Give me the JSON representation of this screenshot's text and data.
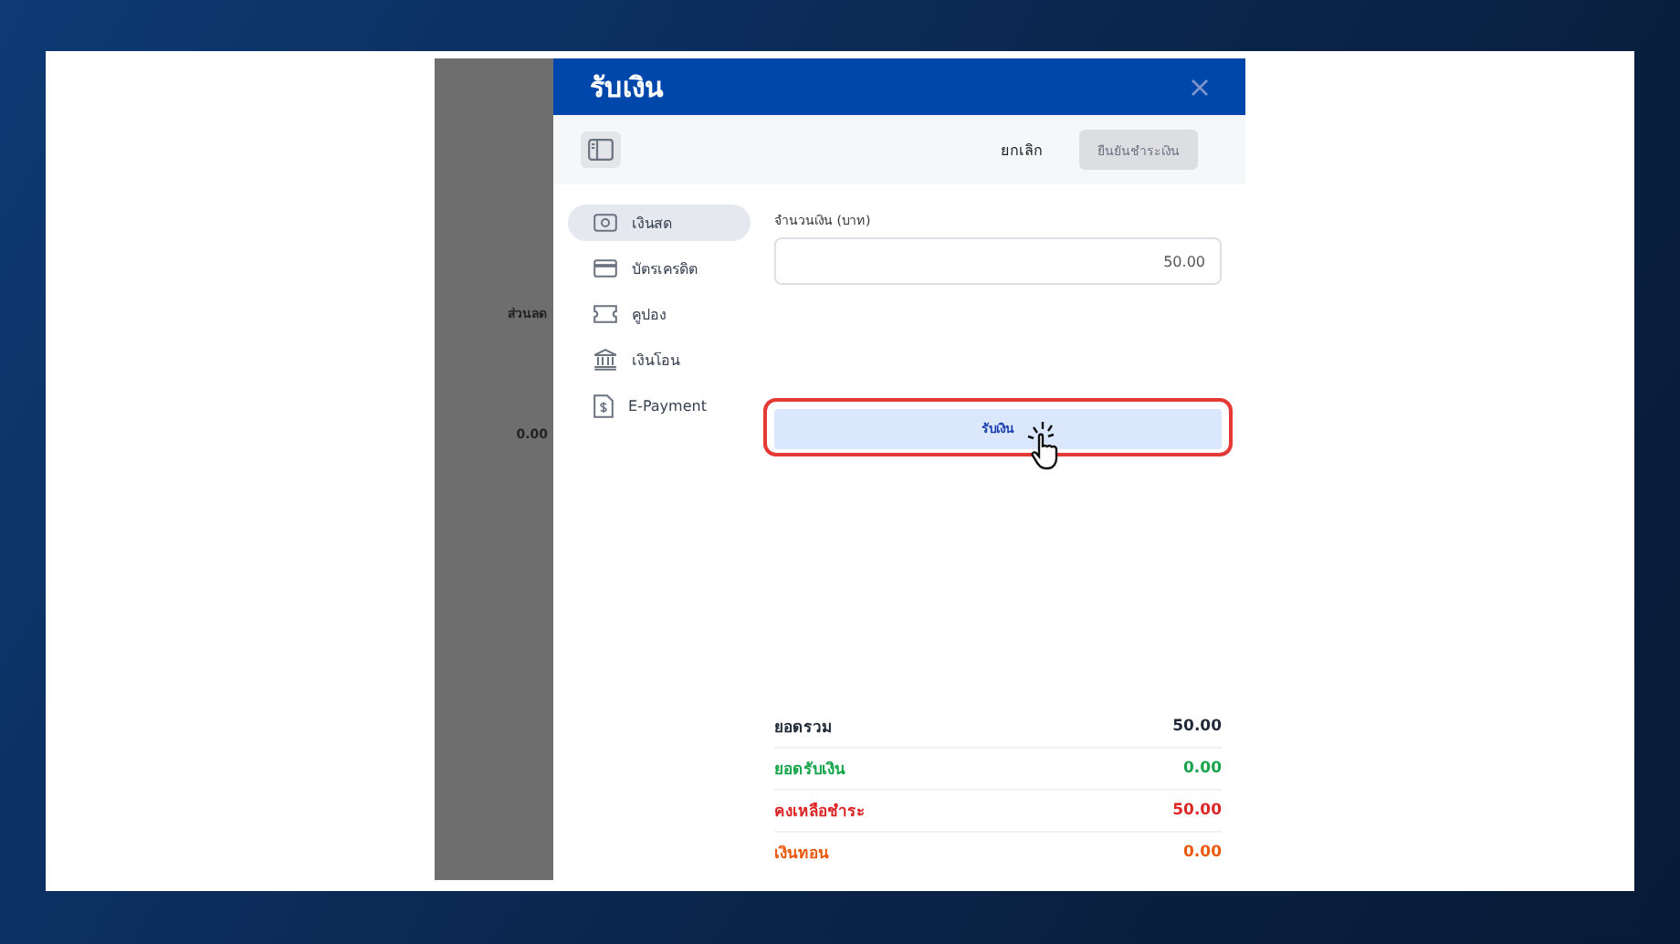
{
  "background_page": {
    "labels": [
      {
        "text": "ส่วนลด"
      },
      {
        "text": "0.00"
      }
    ]
  },
  "modal": {
    "title": "รับเงิน",
    "toolbar": {
      "cancel": "ยกเลิก",
      "confirm": {
        "label": "ยืนยันชำระเงิน",
        "disabled": true
      }
    },
    "payment_methods": [
      {
        "kind": "cash",
        "label": "เงินสด",
        "selected": true
      },
      {
        "kind": "card",
        "label": "บัตรเครดิต",
        "selected": false
      },
      {
        "kind": "coupon",
        "label": "คูปอง",
        "selected": false
      },
      {
        "kind": "bank",
        "label": "เงินโอน",
        "selected": false
      },
      {
        "kind": "epayment",
        "label": "E-Payment",
        "selected": false
      }
    ],
    "amount_field": {
      "label": "จำนวนเงิน (บาท)",
      "value": "50.00"
    },
    "receive_button": {
      "label": "รับเงิน",
      "highlighted": true
    },
    "summary": [
      {
        "label": "ยอดรวม",
        "value": "50.00",
        "color": "#1f2937"
      },
      {
        "label": "ยอดรับเงิน",
        "value": "0.00",
        "color": "#16a34a"
      },
      {
        "label": "คงเหลือชำระ",
        "value": "50.00",
        "color": "#dc2626"
      },
      {
        "label": "เงินทอน",
        "value": "0.00",
        "color": "#ea580c"
      }
    ]
  }
}
